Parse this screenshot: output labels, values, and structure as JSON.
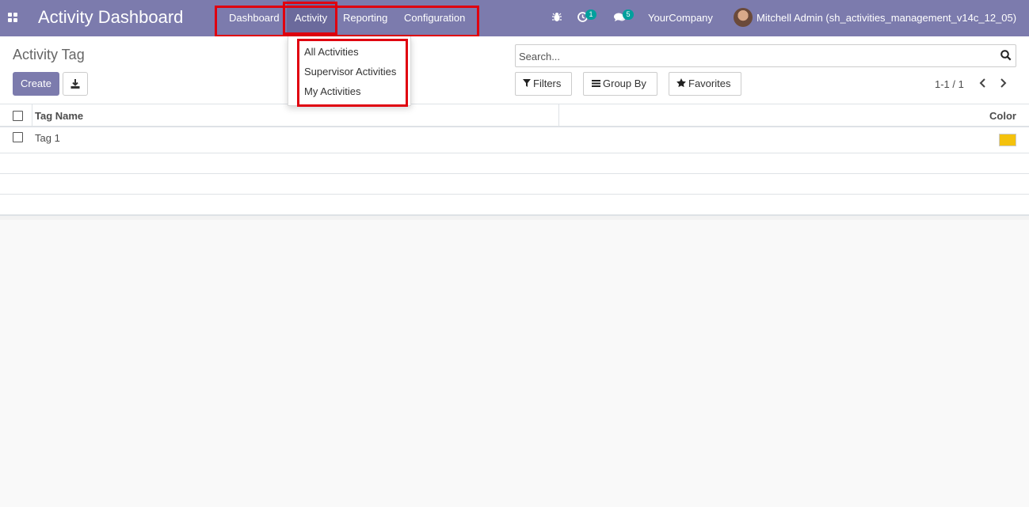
{
  "navbar": {
    "brand": "Activity Dashboard",
    "menu": [
      {
        "label": "Dashboard"
      },
      {
        "label": "Activity"
      },
      {
        "label": "Reporting"
      },
      {
        "label": "Configuration"
      }
    ],
    "activity_badge": "1",
    "message_badge": "5",
    "company": "YourCompany",
    "user": "Mitchell Admin (sh_activities_management_v14c_12_05)",
    "colors": {
      "bar": "#7c7bad",
      "badge": "#00a09d",
      "highlight": "#e0000f"
    }
  },
  "activity_menu": {
    "items": [
      {
        "label": "All Activities"
      },
      {
        "label": "Supervisor Activities"
      },
      {
        "label": "My Activities"
      }
    ]
  },
  "control_panel": {
    "breadcrumb": "Activity Tag",
    "create_label": "Create",
    "search_placeholder": "Search...",
    "filters_label": "Filters",
    "groupby_label": "Group By",
    "favorites_label": "Favorites",
    "pager": "1-1 / 1"
  },
  "list": {
    "columns": {
      "name": "Tag Name",
      "color": "Color"
    },
    "rows": [
      {
        "name": "Tag 1",
        "color": "#f4c20d"
      }
    ]
  }
}
